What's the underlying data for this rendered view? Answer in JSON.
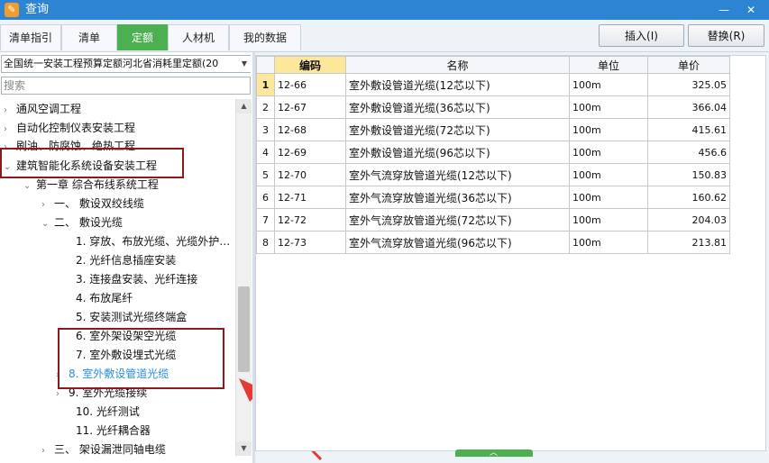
{
  "window": {
    "title": "查询",
    "minimize_glyph": "—",
    "close_glyph": "✕",
    "icon": "app-icon"
  },
  "tabs": [
    {
      "label": "清单指引"
    },
    {
      "label": "清单"
    },
    {
      "label": "定额"
    },
    {
      "label": "人材机"
    },
    {
      "label": "我的数据"
    }
  ],
  "active_tab": "定额",
  "toolbar": {
    "insert_label": "插入(I)",
    "replace_label": "替换(R)"
  },
  "left_panel": {
    "quota_library": "全国统一安装工程预算定额河北省消耗里定额(20",
    "search_placeholder": "搜索",
    "tree": [
      {
        "label": "通风空调工程",
        "arrow": "›"
      },
      {
        "label": "自动化控制仪表安装工程",
        "arrow": "›"
      },
      {
        "label": "刷油、防腐蚀、绝热工程",
        "arrow": "›"
      },
      {
        "label": "建筑智能化系统设备安装工程",
        "arrow": "⌄"
      },
      {
        "label": "第一章 综合布线系统工程",
        "arrow": "⌄"
      },
      {
        "label": "一、 敷设双绞线缆",
        "arrow": "›"
      },
      {
        "label": "二、 敷设光缆",
        "arrow": "⌄"
      },
      {
        "label": "1. 穿放、布放光缆、光缆外护…",
        "arrow": ""
      },
      {
        "label": "2. 光纤信息插座安装",
        "arrow": ""
      },
      {
        "label": "3. 连接盘安装、光纤连接",
        "arrow": ""
      },
      {
        "label": "4. 布放尾纤",
        "arrow": ""
      },
      {
        "label": "5. 安装测试光缆终端盒",
        "arrow": ""
      },
      {
        "label": "6. 室外架设架空光缆",
        "arrow": ""
      },
      {
        "label": "7. 室外敷设埋式光缆",
        "arrow": ""
      },
      {
        "label": "8. 室外敷设管道光缆",
        "arrow": "›"
      },
      {
        "label": "9. 室外光缆接续",
        "arrow": "›"
      },
      {
        "label": "10. 光纤测试",
        "arrow": ""
      },
      {
        "label": "11. 光纤耦合器",
        "arrow": ""
      },
      {
        "label": "三、 架设漏泄同轴电缆",
        "arrow": "›"
      }
    ],
    "selected_item": "8. 室外敷设管道光缆"
  },
  "grid": {
    "columns": [
      "编码",
      "名称",
      "单位",
      "单价"
    ],
    "sorted_column": "编码",
    "rows": [
      {
        "no": "1",
        "code": "12-66",
        "name": "室外敷设管道光缆(12芯以下)",
        "unit": "100m",
        "price": "325.05"
      },
      {
        "no": "2",
        "code": "12-67",
        "name": "室外敷设管道光缆(36芯以下)",
        "unit": "100m",
        "price": "366.04"
      },
      {
        "no": "3",
        "code": "12-68",
        "name": "室外敷设管道光缆(72芯以下)",
        "unit": "100m",
        "price": "415.61"
      },
      {
        "no": "4",
        "code": "12-69",
        "name": "室外敷设管道光缆(96芯以下)",
        "unit": "100m",
        "price": "456.6"
      },
      {
        "no": "5",
        "code": "12-70",
        "name": "室外气流穿放管道光缆(12芯以下)",
        "unit": "100m",
        "price": "150.83"
      },
      {
        "no": "6",
        "code": "12-71",
        "name": "室外气流穿放管道光缆(36芯以下)",
        "unit": "100m",
        "price": "160.62"
      },
      {
        "no": "7",
        "code": "12-72",
        "name": "室外气流穿放管道光缆(72芯以下)",
        "unit": "100m",
        "price": "204.03"
      },
      {
        "no": "8",
        "code": "12-73",
        "name": "室外气流穿放管道光缆(96芯以下)",
        "unit": "100m",
        "price": "213.81"
      }
    ],
    "current_row": "1"
  },
  "colors": {
    "title_bar": "#2c84d2",
    "active_tab": "#4caf50",
    "selected_text": "#2a8fd8",
    "annotation_box": "#8b1a1a",
    "annotation_arrow": "#e53935",
    "sorted_header": "#fde79b"
  }
}
